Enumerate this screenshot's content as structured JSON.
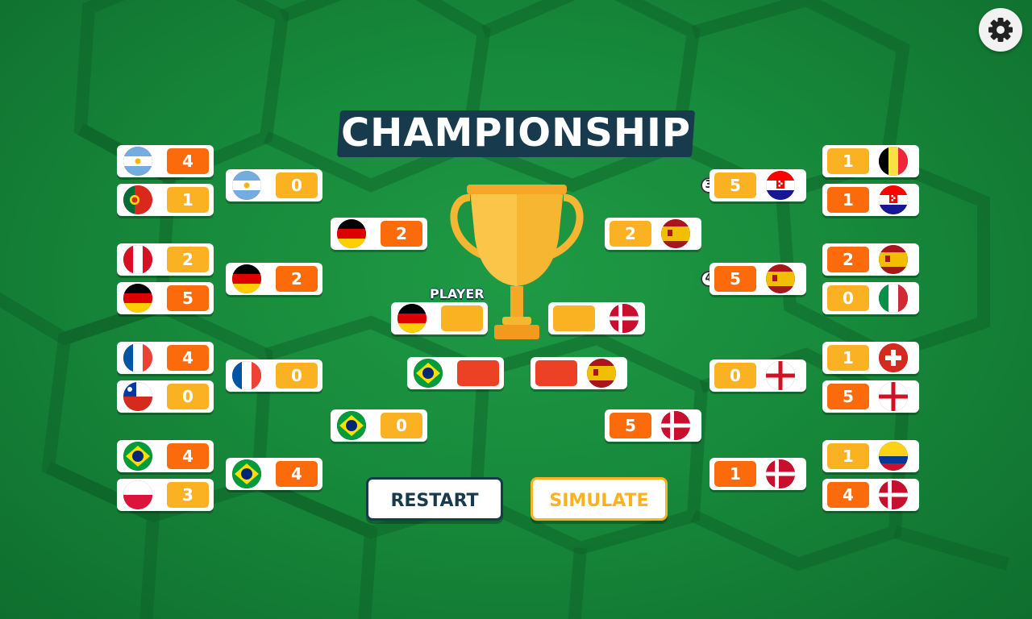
{
  "title": "CHAMPIONSHIP",
  "player_label": "PLAYER",
  "buttons": {
    "restart": "RESTART",
    "simulate": "SIMULATE"
  },
  "settings_icon": "gear-icon",
  "trophy_icon": "trophy-icon",
  "colors": {
    "orange": "#fb6a0b",
    "yellow": "#fbb222",
    "red": "#ec4124",
    "navy": "#173b4d"
  },
  "left": {
    "round_of_16": [
      {
        "team": "Argentina",
        "score": "4"
      },
      {
        "team": "Portugal",
        "score": "1"
      },
      {
        "team": "Peru",
        "score": "2"
      },
      {
        "team": "Germany",
        "score": "5"
      },
      {
        "team": "France",
        "score": "4"
      },
      {
        "team": "Chile",
        "score": "0"
      },
      {
        "team": "Brazil",
        "score": "4"
      },
      {
        "team": "Poland",
        "score": "3"
      }
    ],
    "quarter_finals": [
      {
        "team": "Argentina",
        "score": "0"
      },
      {
        "team": "Germany",
        "score": "2"
      },
      {
        "team": "France",
        "score": "0"
      },
      {
        "team": "Brazil",
        "score": "4"
      }
    ],
    "semi_finals": [
      {
        "team": "Germany",
        "score": "2"
      },
      {
        "team": "Brazil",
        "score": "0"
      }
    ]
  },
  "right": {
    "round_of_16": [
      {
        "team": "Belgium",
        "score": "1"
      },
      {
        "team": "Croatia",
        "score": "1"
      },
      {
        "team": "Spain",
        "score": "2"
      },
      {
        "team": "Italy",
        "score": "0"
      },
      {
        "team": "Switzerland",
        "score": "1"
      },
      {
        "team": "England",
        "score": "5"
      },
      {
        "team": "Colombia",
        "score": "1"
      },
      {
        "team": "Denmark",
        "score": "4"
      }
    ],
    "quarter_finals": [
      {
        "team": "Croatia",
        "score": "5",
        "penalties": "3"
      },
      {
        "team": "Spain",
        "score": "5",
        "penalties": "4"
      },
      {
        "team": "England",
        "score": "0"
      },
      {
        "team": "Denmark",
        "score": "1"
      }
    ],
    "semi_finals": [
      {
        "team": "Spain",
        "score": "2"
      },
      {
        "team": "Denmark",
        "score": "5"
      }
    ]
  },
  "final": {
    "left_team": "Germany",
    "left_score": "",
    "right_team": "Denmark",
    "right_score": ""
  },
  "third_place": {
    "left_team": "Brazil",
    "left_score": "",
    "right_team": "Spain",
    "right_score": ""
  }
}
